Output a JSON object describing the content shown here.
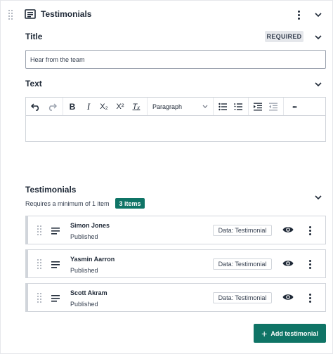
{
  "block": {
    "title": "Testimonials"
  },
  "title_field": {
    "label": "Title",
    "required_badge": "REQUIRED",
    "value": "Hear from the team"
  },
  "text_field": {
    "label": "Text",
    "toolbar": {
      "paragraph_select": "Paragraph",
      "undo_icon": "↶",
      "redo_icon": "↷",
      "bold": "B",
      "italic": "I",
      "subscript": "X₂",
      "superscript": "X²",
      "clear_format": "Tₓ",
      "more": "•••"
    }
  },
  "testimonials": {
    "label": "Testimonials",
    "requirement": "Requires a minimum of 1 item",
    "count_badge": "3 items",
    "items": [
      {
        "name": "Simon Jones",
        "status": "Published",
        "tag": "Data: Testimonial"
      },
      {
        "name": "Yasmin Aarron",
        "status": "Published",
        "tag": "Data: Testimonial"
      },
      {
        "name": "Scott Akram",
        "status": "Published",
        "tag": "Data: Testimonial"
      }
    ],
    "add_button": "Add testimonial"
  },
  "colors": {
    "accent": "#0f7466",
    "badge_bg": "#e5e7eb",
    "border": "#d1d5db"
  }
}
